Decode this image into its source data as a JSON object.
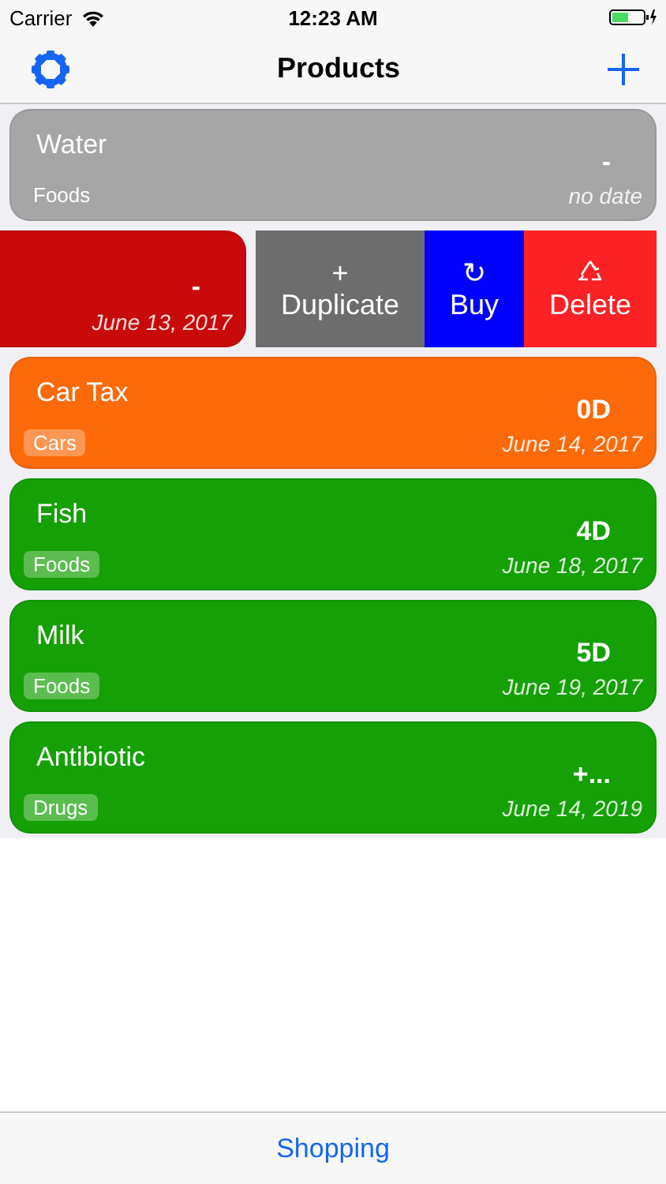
{
  "status_bar": {
    "carrier": "Carrier",
    "time": "12:23 AM"
  },
  "nav_bar": {
    "title": "Products"
  },
  "products": [
    {
      "name": "Water",
      "category": "Foods",
      "category_badge": false,
      "remaining": "-",
      "date": "no date",
      "color": "#a6a6a6",
      "swiped": false
    },
    {
      "remaining": "-",
      "date": "June 13, 2017",
      "color": "#c90a0a",
      "swiped": true,
      "actions": [
        {
          "kind": "duplicate",
          "glyph": "+",
          "label": "Duplicate",
          "color": "#6d6d6d"
        },
        {
          "kind": "buy",
          "glyph": "↻",
          "label": "Buy",
          "color": "#0000ff"
        },
        {
          "kind": "delete",
          "label": "Delete",
          "color": "#fc2125"
        }
      ]
    },
    {
      "name": "Car Tax",
      "category": "Cars",
      "category_badge": true,
      "remaining": "0D",
      "date": "June 14, 2017",
      "color": "#fd6a0a",
      "swiped": false
    },
    {
      "name": "Fish",
      "category": "Foods",
      "category_badge": true,
      "remaining": "4D",
      "date": "June 18, 2017",
      "color": "#15a005",
      "swiped": false
    },
    {
      "name": "Milk",
      "category": "Foods",
      "category_badge": true,
      "remaining": "5D",
      "date": "June 19, 2017",
      "color": "#15a005",
      "swiped": false
    },
    {
      "name": "Antibiotic",
      "category": "Drugs",
      "category_badge": true,
      "remaining": "+...",
      "date": "June 14, 2019",
      "color": "#15a005",
      "swiped": false
    }
  ],
  "tab_bar": {
    "label": "Shopping"
  }
}
